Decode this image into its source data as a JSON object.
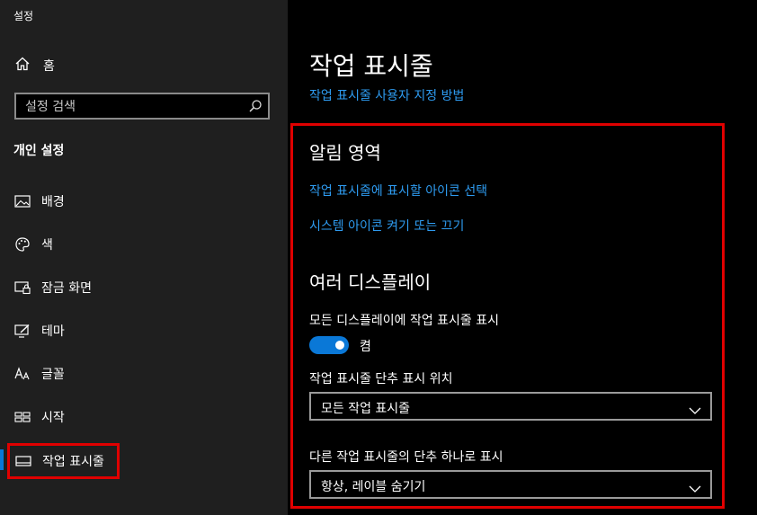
{
  "window": {
    "title": "설정"
  },
  "sidebar": {
    "home_label": "홈",
    "search_placeholder": "설정 검색",
    "section_label": "개인 설정",
    "items": [
      {
        "label": "배경",
        "icon": "picture-icon"
      },
      {
        "label": "색",
        "icon": "palette-icon"
      },
      {
        "label": "잠금 화면",
        "icon": "lock-screen-icon"
      },
      {
        "label": "테마",
        "icon": "theme-icon"
      },
      {
        "label": "글꼴",
        "icon": "font-icon"
      },
      {
        "label": "시작",
        "icon": "start-icon"
      },
      {
        "label": "작업 표시줄",
        "icon": "taskbar-icon",
        "selected": true
      }
    ]
  },
  "main": {
    "title": "작업 표시줄",
    "customize_link": "작업 표시줄 사용자 지정 방법",
    "notification_area": {
      "heading": "알림 영역",
      "link_select_icons": "작업 표시줄에 표시할 아이콘 선택",
      "link_system_icons": "시스템 아이콘 켜기 또는 끄기"
    },
    "multiple_displays": {
      "heading": "여러 디스플레이",
      "show_all_label": "모든 디스플레이에 작업 표시줄 표시",
      "toggle_state": "켬",
      "buttons_position_label": "작업 표시줄 단추 표시 위치",
      "buttons_position_value": "모든 작업 표시줄",
      "combine_label": "다른 작업 표시줄의 단추 하나로 표시",
      "combine_value": "항상, 레이블 숨기기"
    }
  },
  "colors": {
    "accent": "#0a78d7",
    "link": "#2e9bf0",
    "highlight_border": "#e00000",
    "sidebar_bg": "#1f1f1f",
    "main_bg": "#000000"
  }
}
